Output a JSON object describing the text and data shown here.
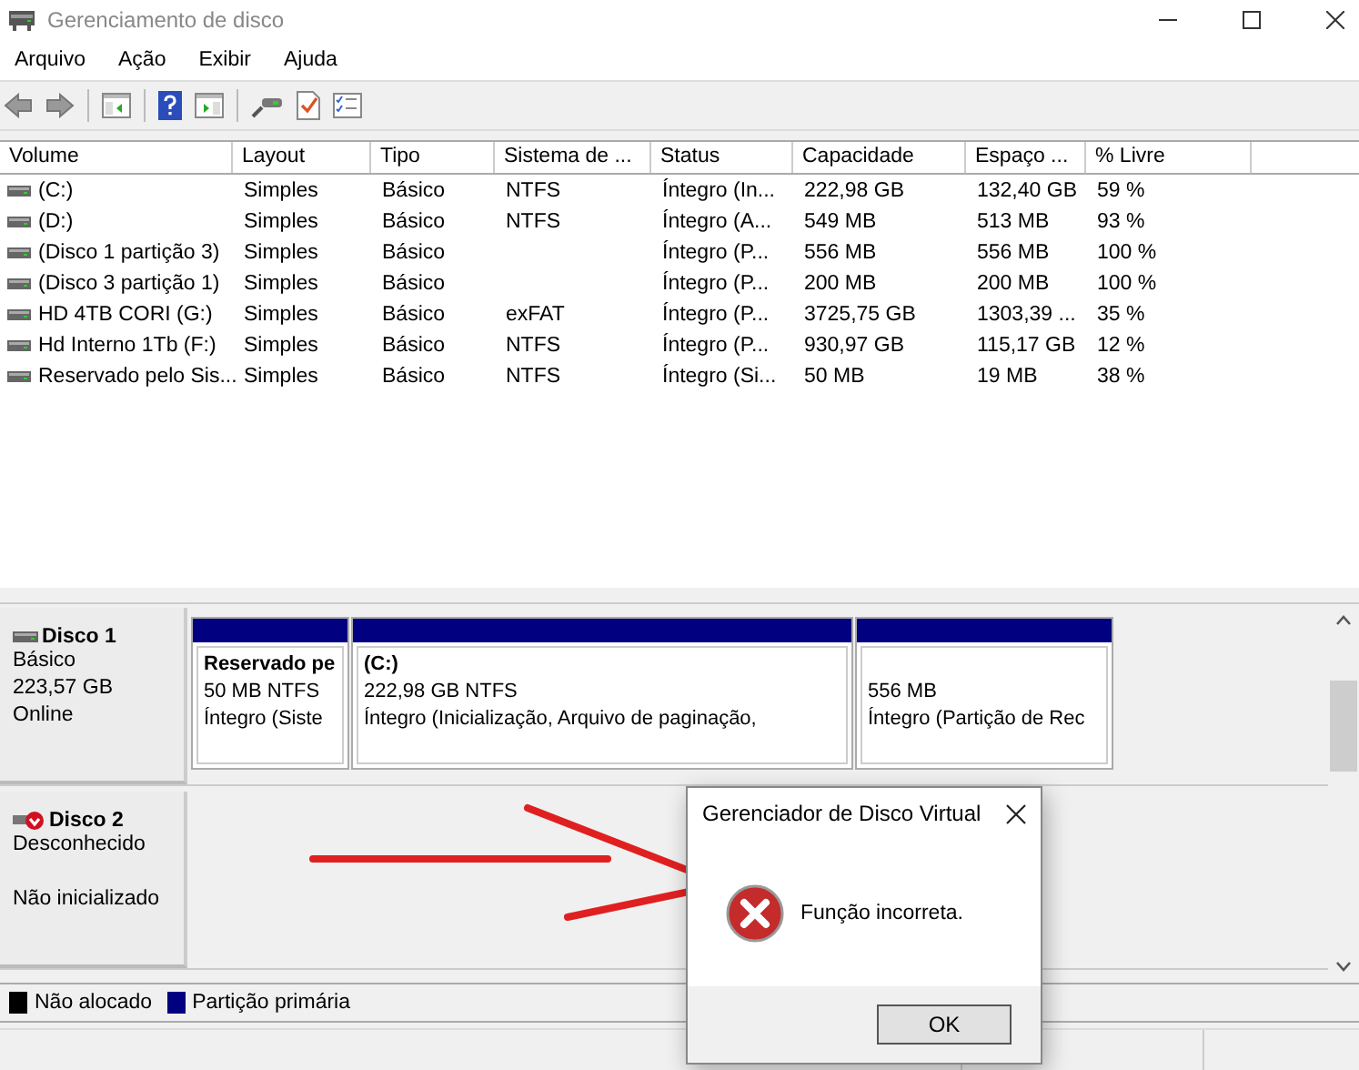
{
  "window": {
    "title": "Gerenciamento de disco"
  },
  "menu": [
    "Arquivo",
    "Ação",
    "Exibir",
    "Ajuda"
  ],
  "table": {
    "columns": [
      "Volume",
      "Layout",
      "Tipo",
      "Sistema de ...",
      "Status",
      "Capacidade",
      "Espaço ...",
      "% Livre"
    ],
    "rows": [
      [
        "(C:)",
        "Simples",
        "Básico",
        "NTFS",
        "Íntegro (In...",
        "222,98 GB",
        "132,40 GB",
        "59 %"
      ],
      [
        "(D:)",
        "Simples",
        "Básico",
        "NTFS",
        "Íntegro (A...",
        "549 MB",
        "513 MB",
        "93 %"
      ],
      [
        "(Disco 1 partição 3)",
        "Simples",
        "Básico",
        "",
        "Íntegro (P...",
        "556 MB",
        "556 MB",
        "100 %"
      ],
      [
        "(Disco 3 partição 1)",
        "Simples",
        "Básico",
        "",
        "Íntegro (P...",
        "200 MB",
        "200 MB",
        "100 %"
      ],
      [
        "HD 4TB CORI (G:)",
        "Simples",
        "Básico",
        "exFAT",
        "Íntegro (P...",
        "3725,75 GB",
        "1303,39 ...",
        "35 %"
      ],
      [
        "Hd Interno 1Tb (F:)",
        "Simples",
        "Básico",
        "NTFS",
        "Íntegro (P...",
        "930,97 GB",
        "115,17 GB",
        "12 %"
      ],
      [
        "Reservado pelo Sis...",
        "Simples",
        "Básico",
        "NTFS",
        "Íntegro (Si...",
        "50 MB",
        "19 MB",
        "38 %"
      ]
    ]
  },
  "disks": [
    {
      "kind": "online",
      "name": "Disco 1",
      "lines": [
        "Básico",
        "223,57 GB",
        "Online"
      ],
      "partitions": [
        {
          "name": "Reservado pe",
          "size": "50 MB NTFS",
          "status": "Íntegro (Siste"
        },
        {
          "name": "(C:)",
          "size": "222,98 GB NTFS",
          "status": "Íntegro (Inicialização, Arquivo de paginação,"
        },
        {
          "size": "556 MB",
          "status": "Íntegro (Partição de Rec"
        }
      ]
    },
    {
      "kind": "error",
      "name": "Disco 2",
      "lines": [
        "Desconhecido",
        "Não inicializado"
      ]
    }
  ],
  "legend": [
    {
      "label": "Não alocado",
      "color": "#000000"
    },
    {
      "label": "Partição primária",
      "color": "#000080"
    }
  ],
  "dialog": {
    "title": "Gerenciador de Disco Virtual",
    "message": "Função incorreta.",
    "button": "OK"
  }
}
